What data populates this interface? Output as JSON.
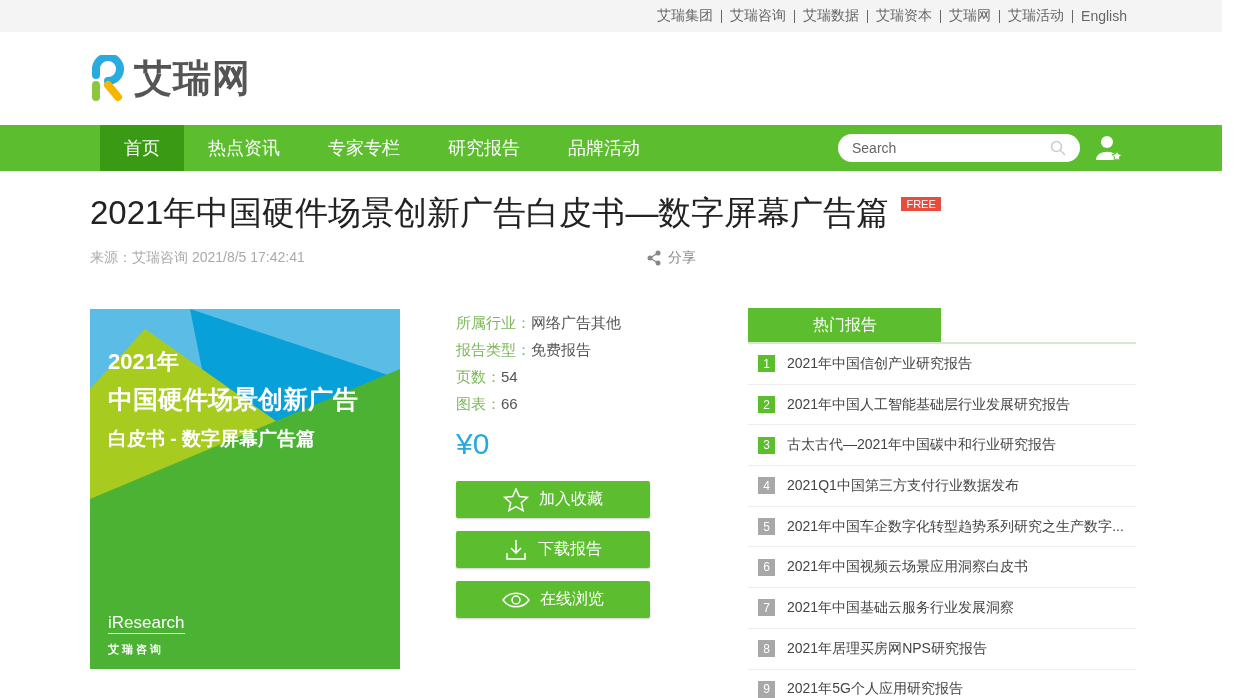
{
  "top_links": [
    "艾瑞集团",
    "艾瑞咨询",
    "艾瑞数据",
    "艾瑞资本",
    "艾瑞网",
    "艾瑞活动",
    "English"
  ],
  "logo": {
    "text": "艾瑞网"
  },
  "nav": {
    "items": [
      {
        "label": "首页",
        "selected": true
      },
      {
        "label": "热点资讯",
        "selected": false
      },
      {
        "label": "专家专栏",
        "selected": false
      },
      {
        "label": "研究报告",
        "selected": false
      },
      {
        "label": "品牌活动",
        "selected": false
      }
    ],
    "search": {
      "placeholder": "Search"
    }
  },
  "article": {
    "title": "2021年中国硬件场景创新广告白皮书—数字屏幕广告篇",
    "badge": "FREE",
    "meta": "来源：艾瑞咨询 2021/8/5 17:42:41",
    "share": "分享"
  },
  "cover": {
    "year": "2021年",
    "title_line": "中国硬件场景创新广告",
    "subtitle": "白皮书 - 数字屏幕广告篇",
    "brand": "iResearch",
    "brand_cn": "艾 瑞 咨 询"
  },
  "info": [
    {
      "label": "所属行业：",
      "value": "网络广告其他"
    },
    {
      "label": "报告类型：",
      "value": "免费报告"
    },
    {
      "label": "页数：",
      "value": "54"
    },
    {
      "label": "图表：",
      "value": "66"
    }
  ],
  "price": "¥0",
  "actions": [
    {
      "kind": "star",
      "label": "加入收藏"
    },
    {
      "kind": "download",
      "label": "下载报告"
    },
    {
      "kind": "eye",
      "label": "在线浏览"
    }
  ],
  "hot_reports": {
    "title": "热门报告",
    "items": [
      {
        "rank": "1",
        "highlighted": true,
        "title": "2021年中国信创产业研究报告"
      },
      {
        "rank": "2",
        "highlighted": true,
        "title": "2021年中国人工智能基础层行业发展研究报告"
      },
      {
        "rank": "3",
        "highlighted": true,
        "title": "古太古代—2021年中国碳中和行业研究报告"
      },
      {
        "rank": "4",
        "highlighted": false,
        "title": "2021Q1中国第三方支付行业数据发布"
      },
      {
        "rank": "5",
        "highlighted": false,
        "title": "2021年中国车企数字化转型趋势系列研究之生产数字..."
      },
      {
        "rank": "6",
        "highlighted": false,
        "title": "2021年中国视频云场景应用洞察白皮书"
      },
      {
        "rank": "7",
        "highlighted": false,
        "title": "2021年中国基础云服务行业发展洞察"
      },
      {
        "rank": "8",
        "highlighted": false,
        "title": "2021年居理买房网NPS研究报告"
      },
      {
        "rank": "9",
        "highlighted": false,
        "title": "2021年5G个人应用研究报告"
      }
    ]
  }
}
